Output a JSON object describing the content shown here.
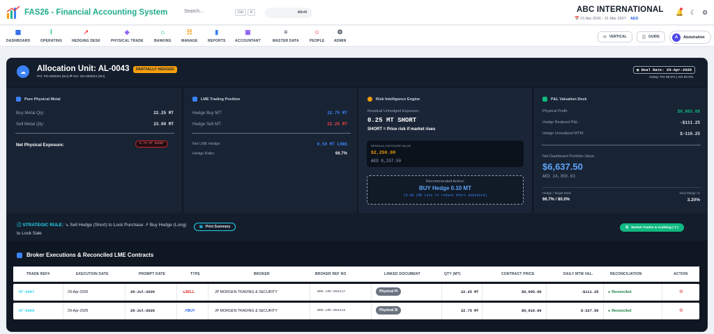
{
  "app": {
    "title": "FAS26 - Financial Accounting System"
  },
  "search": {
    "placeholder": "Search...",
    "kbd1": "Ctrl",
    "kbd2": "K",
    "alt_label": "Alt+N"
  },
  "company": {
    "name": "ABC INTERNATIONAL",
    "period": "01 Apr 2026 - 31 Mar 2027",
    "currency": "AED"
  },
  "nav": {
    "items": [
      "DASHBOARD",
      "OPERATING",
      "HEDGING DESK",
      "PHYSICAL TRADE",
      "BANKING",
      "MANAGE",
      "REPORTS",
      "ACCOUNTANT",
      "MASTER DATA",
      "PEOPLE",
      "ADMIN"
    ],
    "icons": [
      "grid-icon",
      "activity-icon",
      "trending-up-icon",
      "cube-icon",
      "bank-icon",
      "sliders-icon",
      "bar-chart-icon",
      "book-icon",
      "database-icon",
      "people-icon",
      "gear-icon"
    ],
    "vertical_label": "VERTICAL",
    "guide_label": "GUIDE",
    "user_name": "Abdulrahim",
    "user_initial": "A"
  },
  "allocation": {
    "title": "Allocation Unit: AL-0043",
    "status": "PARTIALLY HEDGED",
    "links": "PO: PO-000034 (SH) ⇄ SO: SO-000004 (SH)",
    "deal_date": "Deal Date: 29-Apr-2026",
    "assay": "Assay: PO 99.0% | SO 92.0%"
  },
  "physical": {
    "title": "Pure Physical Metal",
    "buy_label": "Buy Metal Qty:",
    "buy_value": "22.25 MT",
    "sell_label": "Sell Metal Qty:",
    "sell_value": "23.00 MT",
    "net_label": "Net Physical Exposure:",
    "net_value": "0.75 MT SHORT"
  },
  "lme": {
    "title": "LME Trading Position",
    "hedge_buy_label": "Hedge Buy MT:",
    "hedge_buy_value": "22.75 MT",
    "hedge_sell_label": "Hedge Sell MT:",
    "hedge_sell_value": "22.25 MT",
    "net_label": "Net LME Hedge:",
    "net_value": "0.50 MT LONG",
    "ratio_label": "Hedge Ratio:",
    "ratio_value": "66.7%"
  },
  "risk": {
    "title": "Risk Intelligence Engine",
    "residual_label": "Residual Unhedged Exposure:",
    "residual_value": "0.25 MT SHORT",
    "note": "SHORT = Price risk if market rises",
    "res_value_label": "RESIDUAL EXPOSURE VALUE",
    "res_value_usd": "$2,250.00",
    "res_value_aed": "AED 8,257.50",
    "rec_label": "Recommended Action:",
    "rec_action": "BUY Hedge 0.10 MT",
    "rec_note": "(0.00 LME Lots to reduce short exposure)"
  },
  "pnl": {
    "title": "P&L Valuation Desk",
    "phys_label": "Physical Profit:",
    "phys_value": "$6,865.00",
    "realized_label": "Hedge Realized P&L:",
    "realized_value": "-$111.25",
    "unreal_label": "Hedge Unrealized MTM:",
    "unreal_value": "$-116.25",
    "net_label": "Net Dashboard Portfolio Value:",
    "net_usd": "$6,637.50",
    "net_aed": "AED 24,359.63",
    "ratio_label": "Hedge / Target Ratio",
    "ratio_value": "66.7% / 80.0%",
    "margin_label": "Deal Margin %",
    "margin_value": "3.20%"
  },
  "strategic": {
    "label": "STRATEGIC RULE:",
    "text1": "Sell Hedge (Short) to Lock Purchase",
    "text2": "Buy Hedge (Long) to Lock Sale",
    "print_label": "Print Summary",
    "market_label": "Market Trades & Auditing ( 2 )"
  },
  "broker": {
    "title": "Broker Executions & Reconciled LME Contracts",
    "columns": [
      "TRADE REF#",
      "EXECUTION DATE",
      "PROMPT DATE",
      "TYPE",
      "BROKER",
      "BROKER REF NO",
      "LINKED DOCUMENT",
      "QTY (MT)",
      "CONTRACT PRICE",
      "DAILY MTM VAL.",
      "RECONCILIATION",
      "ACTION"
    ],
    "rows": [
      {
        "ref": "HT-0007",
        "exec": "29-Apr-2026",
        "prompt": "29-Jul-2026",
        "type": "SELL",
        "broker": "JP MORGEN TRADING & SECURITY",
        "broker_ref": "BRK-LME-004217",
        "doc": "Physical PI",
        "qty": "22.25 MT",
        "price": "$9,005.00",
        "mtm": "-$111.25",
        "recon": "Reconciled"
      },
      {
        "ref": "HT-0008",
        "exec": "29-Apr-2026",
        "prompt": "29-Jul-2026",
        "type": "BUY",
        "broker": "JP MORGEN TRADING & SECURITY",
        "broker_ref": "BRK-LME-004218",
        "doc": "Physical SI",
        "qty": "22.75 MT",
        "price": "$9,010.00",
        "mtm": "$-227.50",
        "recon": "Reconciled"
      }
    ]
  },
  "colors": {
    "brand": "#1fae8c",
    "accent": "#2563eb",
    "warning": "#f59e0b",
    "danger": "#dc2626",
    "success": "#10b981",
    "panel": "#0f1722"
  }
}
